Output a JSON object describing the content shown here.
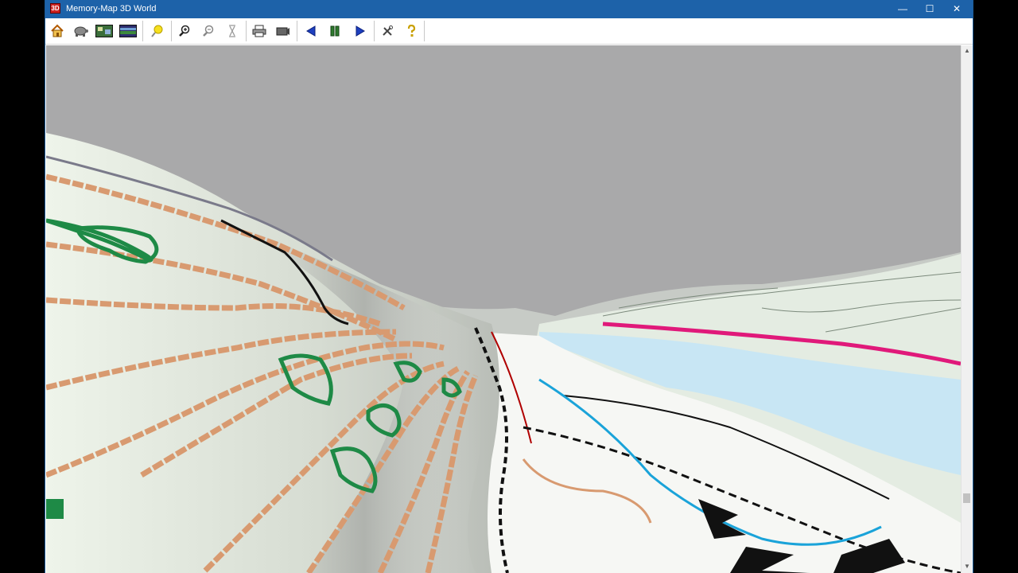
{
  "window": {
    "title": "Memory-Map 3D World",
    "app_icon_text": "3D",
    "controls": {
      "minimize": "—",
      "maximize": "☐",
      "close": "✕"
    }
  },
  "toolbar": {
    "buttons": [
      {
        "name": "home-button",
        "icon": "home-icon"
      },
      {
        "name": "tortoise-button",
        "icon": "tortoise-icon"
      },
      {
        "name": "map-view-button",
        "icon": "map-icon"
      },
      {
        "name": "panorama-button",
        "icon": "panorama-icon"
      },
      {
        "name": "sun-button",
        "icon": "sun-icon"
      },
      {
        "name": "zoom-in-button",
        "icon": "zoom-in-icon"
      },
      {
        "name": "zoom-out-button",
        "icon": "zoom-out-icon"
      },
      {
        "name": "height-scale-button",
        "icon": "hourglass-icon"
      },
      {
        "name": "print-button",
        "icon": "printer-icon"
      },
      {
        "name": "export-button",
        "icon": "camera-icon"
      },
      {
        "name": "reverse-button",
        "icon": "play-left-icon"
      },
      {
        "name": "pause-button",
        "icon": "pause-icon"
      },
      {
        "name": "forward-button",
        "icon": "play-right-icon"
      },
      {
        "name": "settings-button",
        "icon": "tools-icon"
      },
      {
        "name": "help-button",
        "icon": "help-icon"
      }
    ]
  },
  "colors": {
    "title_bar": "#1d62a9",
    "sky": "#a9a9aa",
    "terrain": "#dfe8dc",
    "contour": "#d89a70",
    "forest": "#1e8a46",
    "water": "#c8e6f4",
    "road_magenta": "#e0197a"
  },
  "scrollbar": {
    "up": "▲",
    "down": "▼"
  }
}
